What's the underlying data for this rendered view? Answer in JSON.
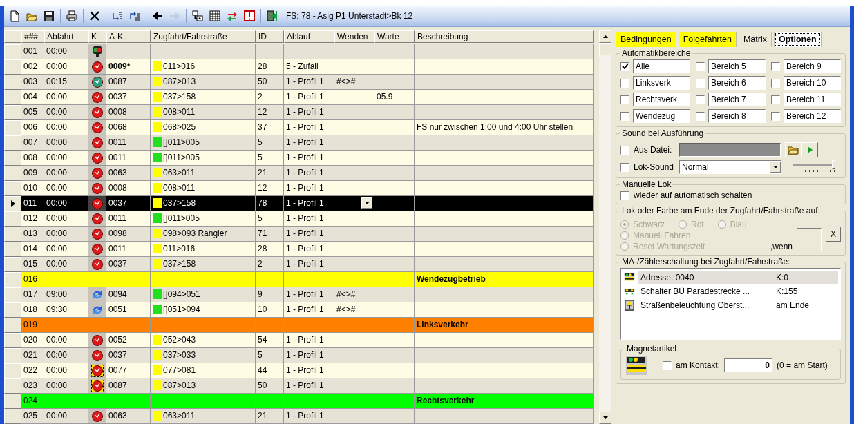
{
  "toolbar": {
    "buttons": [
      {
        "kind": "new",
        "disabled": false
      },
      {
        "kind": "open",
        "disabled": false
      },
      {
        "kind": "save",
        "disabled": false
      },
      {
        "kind": "separator"
      },
      {
        "kind": "print",
        "disabled": false
      },
      {
        "kind": "separator"
      },
      {
        "kind": "delete",
        "disabled": false
      },
      {
        "kind": "separator"
      },
      {
        "kind": "move-down",
        "disabled": false
      },
      {
        "kind": "move-up",
        "disabled": false
      },
      {
        "kind": "separator"
      },
      {
        "kind": "back",
        "disabled": false
      },
      {
        "kind": "forward",
        "disabled": true
      },
      {
        "kind": "separator"
      },
      {
        "kind": "grid-add",
        "disabled": false
      },
      {
        "kind": "table",
        "disabled": false
      },
      {
        "kind": "swap",
        "disabled": false
      },
      {
        "kind": "alert",
        "disabled": false
      },
      {
        "kind": "separator"
      },
      {
        "kind": "exit",
        "disabled": false
      }
    ],
    "title": "FS: 78 - Asig P1 Unterstadt>Bk 12"
  },
  "table": {
    "columns": [
      "###",
      "Abfahrt",
      "K",
      "A-K.",
      "Zugfahrt/Fahrstraße",
      "ID",
      "Ablauf",
      "Wenden",
      "Warte",
      "Beschreibung"
    ],
    "rows": [
      {
        "kind": "entry",
        "no": "001",
        "time": "00:00",
        "k": {
          "kind": "signal"
        },
        "selected": false
      },
      {
        "kind": "entry",
        "no": "002",
        "time": "00:00",
        "k": {
          "kind": "clock-red"
        },
        "ak": "0009*",
        "ak_bold": true,
        "route": {
          "text": "011>016",
          "color": "#ffff00"
        },
        "id": "28",
        "ablauf": "5 - Zufall",
        "selected": false
      },
      {
        "kind": "entry",
        "no": "003",
        "time": "00:15",
        "k": {
          "kind": "clock-green"
        },
        "ak": "0087",
        "ak_bold": false,
        "route": {
          "text": "087>013",
          "color": "#ffff00"
        },
        "id": "50",
        "ablauf": "1 - Profil 1",
        "wenden": "#<>#",
        "selected": false
      },
      {
        "kind": "entry",
        "no": "004",
        "time": "00:00",
        "k": {
          "kind": "clock-red"
        },
        "ak": "0037",
        "ak_bold": false,
        "route": {
          "text": "037>158",
          "color": "#ffff00"
        },
        "id": "2",
        "ablauf": "1 - Profil 1",
        "warte": "05.9",
        "selected": false
      },
      {
        "kind": "entry",
        "no": "005",
        "time": "00:00",
        "k": {
          "kind": "clock-red"
        },
        "ak": "0008",
        "ak_bold": false,
        "route": {
          "text": "008>011",
          "color": "#ffff00"
        },
        "id": "12",
        "ablauf": "1 - Profil 1",
        "selected": false
      },
      {
        "kind": "entry",
        "no": "006",
        "time": "00:00",
        "k": {
          "kind": "clock-red"
        },
        "ak": "0068",
        "ak_bold": false,
        "route": {
          "text": "068>025",
          "color": "#ffff00"
        },
        "id": "37",
        "ablauf": "1 - Profil 1",
        "desc": "FS nur zwischen 1:00 und 4:00 Uhr stellen",
        "selected": false
      },
      {
        "kind": "entry",
        "no": "007",
        "time": "00:00",
        "k": {
          "kind": "clock-red"
        },
        "ak": "0011",
        "ak_bold": false,
        "route": {
          "text": "[]011>005",
          "color": "#20e020"
        },
        "id": "5",
        "ablauf": "1 - Profil 1",
        "selected": false
      },
      {
        "kind": "entry",
        "no": "008",
        "time": "00:00",
        "k": {
          "kind": "clock-red"
        },
        "ak": "0011",
        "ak_bold": false,
        "route": {
          "text": "[]011>005",
          "color": "#20e020"
        },
        "id": "5",
        "ablauf": "1 - Profil 1",
        "selected": false
      },
      {
        "kind": "entry",
        "no": "009",
        "time": "00:00",
        "k": {
          "kind": "clock-red"
        },
        "ak": "0063",
        "ak_bold": false,
        "route": {
          "text": "063>011",
          "color": "#ffff00"
        },
        "id": "21",
        "ablauf": "1 - Profil 1",
        "selected": false
      },
      {
        "kind": "entry",
        "no": "010",
        "time": "00:00",
        "k": {
          "kind": "clock-red"
        },
        "ak": "0008",
        "ak_bold": false,
        "route": {
          "text": "008>011",
          "color": "#ffff00"
        },
        "id": "12",
        "ablauf": "1 - Profil 1",
        "selected": false
      },
      {
        "kind": "entry",
        "no": "011",
        "time": "00:00",
        "k": {
          "kind": "clock-red"
        },
        "ak": "0037",
        "ak_bold": false,
        "route": {
          "text": "037>158",
          "color": "#ffff00"
        },
        "id": "78",
        "ablauf": "1 - Profil 1",
        "selected": true
      },
      {
        "kind": "entry",
        "no": "012",
        "time": "00:00",
        "k": {
          "kind": "clock-red"
        },
        "ak": "0011",
        "ak_bold": false,
        "route": {
          "text": "[]011>005",
          "color": "#20e020"
        },
        "id": "5",
        "ablauf": "1 - Profil 1",
        "selected": false
      },
      {
        "kind": "entry",
        "no": "013",
        "time": "00:00",
        "k": {
          "kind": "clock-red"
        },
        "ak": "0098",
        "ak_bold": false,
        "route": {
          "text": "098>093 Rangier",
          "color": "#ffff00"
        },
        "id": "71",
        "ablauf": "1 - Profil 1",
        "selected": false
      },
      {
        "kind": "entry",
        "no": "014",
        "time": "00:00",
        "k": {
          "kind": "clock-red"
        },
        "ak": "0011",
        "ak_bold": false,
        "route": {
          "text": "011>016",
          "color": "#ffff00"
        },
        "id": "28",
        "ablauf": "1 - Profil 1",
        "selected": false
      },
      {
        "kind": "entry",
        "no": "015",
        "time": "00:00",
        "k": {
          "kind": "clock-red"
        },
        "ak": "0037",
        "ak_bold": false,
        "route": {
          "text": "037>158",
          "color": "#ffff00"
        },
        "id": "2",
        "ablauf": "1 - Profil 1",
        "selected": false
      },
      {
        "kind": "section",
        "no": "016",
        "color": "#ffff00",
        "desc": "Wendezugbetrieb",
        "selected": false
      },
      {
        "kind": "entry",
        "no": "017",
        "time": "09:00",
        "k": {
          "kind": "arrows"
        },
        "ak": "0094",
        "ak_bold": false,
        "route": {
          "text": "[]094>051",
          "color": "#20e020"
        },
        "id": "9",
        "ablauf": "1 - Profil 1",
        "wenden": "#<>#",
        "selected": false
      },
      {
        "kind": "entry",
        "no": "018",
        "time": "09:30",
        "k": {
          "kind": "arrows"
        },
        "ak": "0051",
        "ak_bold": false,
        "route": {
          "text": "[]051>094",
          "color": "#20e020"
        },
        "id": "10",
        "ablauf": "1 - Profil 1",
        "wenden": "#<>#",
        "selected": false
      },
      {
        "kind": "section",
        "no": "019",
        "color": "#ff8000",
        "desc": "Linksverkehr",
        "selected": false
      },
      {
        "kind": "entry",
        "no": "020",
        "time": "00:00",
        "k": {
          "kind": "clock-red"
        },
        "ak": "0052",
        "ak_bold": false,
        "route": {
          "text": "052>043",
          "color": "#ffff00"
        },
        "id": "54",
        "ablauf": "1 - Profil 1",
        "selected": false
      },
      {
        "kind": "entry",
        "no": "021",
        "time": "00:00",
        "k": {
          "kind": "clock-red"
        },
        "ak": "0037",
        "ak_bold": false,
        "route": {
          "text": "037>033",
          "color": "#ffff00"
        },
        "id": "5",
        "ablauf": "1 - Profil 1",
        "selected": false
      },
      {
        "kind": "entry",
        "no": "022",
        "time": "00:00",
        "k": {
          "kind": "clock-red-framed"
        },
        "ak": "0077",
        "ak_bold": false,
        "route": {
          "text": "077>081",
          "color": "#ffff00"
        },
        "id": "44",
        "ablauf": "1 - Profil 1",
        "selected": false
      },
      {
        "kind": "entry",
        "no": "023",
        "time": "00:00",
        "k": {
          "kind": "clock-red-framed"
        },
        "ak": "0087",
        "ak_bold": false,
        "route": {
          "text": "087>013",
          "color": "#ffff00"
        },
        "id": "50",
        "ablauf": "1 - Profil 1",
        "selected": false
      },
      {
        "kind": "section",
        "no": "024",
        "color": "#00ff00",
        "desc": "Rechtsverkehr",
        "selected": false
      },
      {
        "kind": "entry",
        "no": "025",
        "time": "00:00",
        "k": {
          "kind": "clock-red"
        },
        "ak": "0063",
        "ak_bold": false,
        "route": {
          "text": "063>011",
          "color": "#ffff00"
        },
        "id": "21",
        "ablauf": "1 - Profil 1",
        "selected": false
      }
    ]
  },
  "panel": {
    "tabs": [
      {
        "label": "Bedingungen",
        "color": "#ffff00",
        "selected": false
      },
      {
        "label": "Folgefahrten",
        "color": "#ffff00",
        "selected": false
      },
      {
        "label": "Matrix",
        "selected": false
      },
      {
        "label": "Optionen",
        "selected": true
      }
    ],
    "areas": {
      "title": "Automatikbereiche",
      "items": [
        {
          "checked": true,
          "name": "Alle"
        },
        {
          "checked": false,
          "name": "Bereich 5"
        },
        {
          "checked": false,
          "name": "Bereich 9"
        },
        {
          "checked": false,
          "name": "Linksverk"
        },
        {
          "checked": false,
          "name": "Bereich 6"
        },
        {
          "checked": false,
          "name": "Bereich 10"
        },
        {
          "checked": false,
          "name": "Rechtsverk"
        },
        {
          "checked": false,
          "name": "Bereich 7"
        },
        {
          "checked": false,
          "name": "Bereich 11"
        },
        {
          "checked": false,
          "name": "Wendezug"
        },
        {
          "checked": false,
          "name": "Bereich 8"
        },
        {
          "checked": false,
          "name": "Bereich 12"
        }
      ]
    },
    "sound": {
      "title": "Sound bei Ausführung",
      "file": {
        "label": "Aus Datei:",
        "checked": false
      },
      "lok": {
        "label": "Lok-Sound",
        "checked": false,
        "value": "Normal",
        "level": 1
      }
    },
    "manual": {
      "title": "Manuelle Lok",
      "label": "wieder auf automatisch schalten",
      "checked": false
    },
    "end": {
      "title": "Lok oder Farbe am Ende der Zugfahrt/Fahrstraße auf:",
      "disabled": true,
      "options": [
        {
          "label": "Schwarz",
          "selected": true
        },
        {
          "label": "Rot",
          "selected": false
        },
        {
          "label": "Blau",
          "selected": false
        },
        {
          "label": "Manuell Fahren",
          "selected": false
        },
        {
          "label": "Reset Wartungszeit",
          "selected": false
        }
      ],
      "wenn": ",wenn",
      "clear": "X"
    },
    "ma": {
      "title": "MA-/Zählerschaltung bei Zugfahrt/Fahrstraße:",
      "items": [
        {
          "kind": "address",
          "name": "Adresse: 0040",
          "value": "K:0",
          "selected": true
        },
        {
          "kind": "switch",
          "name": "Schalter BÜ Paradestrecke ...",
          "value": "K:155",
          "selected": false
        },
        {
          "kind": "lamp",
          "name": "Straßenbeleuchtung Oberst...",
          "value": "am Ende",
          "selected": false
        }
      ]
    },
    "magnet": {
      "title": "Magnetartikel",
      "label": "am Kontakt:",
      "checked": false,
      "value": "0",
      "note": "(0 = am Start)"
    }
  }
}
